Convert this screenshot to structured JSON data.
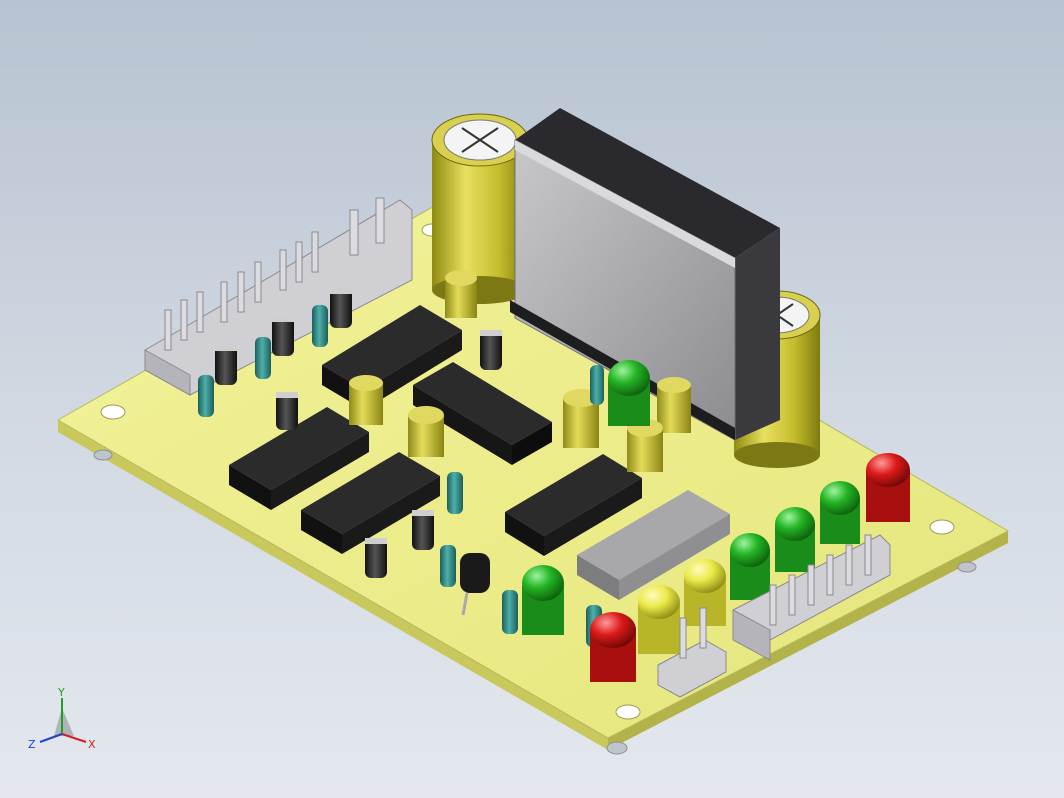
{
  "triad": {
    "x_label": "X",
    "y_label": "Y",
    "z_label": "Z",
    "x_color": "#d42020",
    "y_color": "#22a022",
    "z_color": "#2040d0"
  },
  "colors": {
    "board": "#ecec8a",
    "board_edge": "#d8d86e",
    "ic_body": "#222222",
    "ic_light": "#9a9a9a",
    "cap_gold": "#c8c030",
    "led_green": "#20b020",
    "led_yellow": "#e6e640",
    "led_red": "#d81818",
    "resistor": "#2f8f8a",
    "diode": "#2a2a2a",
    "header": "#c8c8cc",
    "transformer": "#a8a8aa"
  }
}
